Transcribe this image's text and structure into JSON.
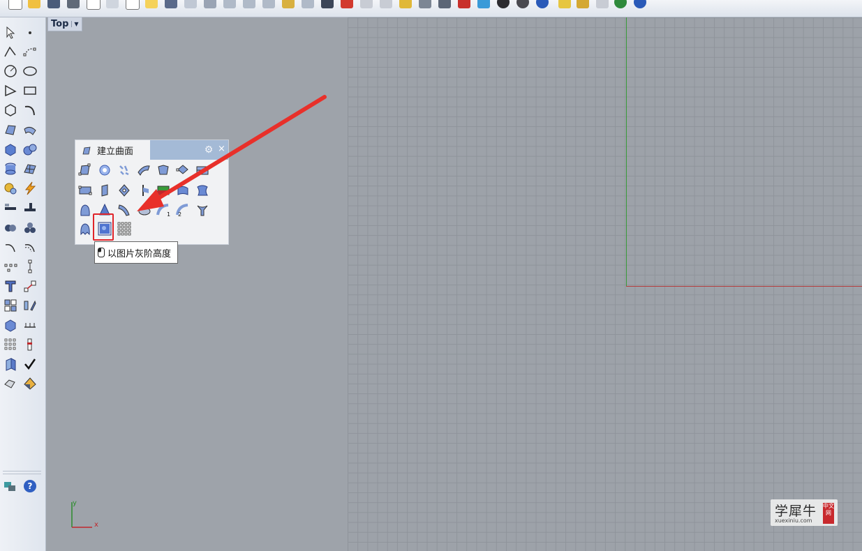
{
  "viewport": {
    "name": "Top",
    "axis_x_label": "x",
    "axis_y_label": "y"
  },
  "panel": {
    "title": "建立曲面",
    "close_glyph": "×",
    "settings_icon": "gear-icon",
    "tooltip": "以图片灰阶高度"
  },
  "watermark": {
    "title": "学犀牛",
    "subtitle": "xuexiniu.com",
    "badge": "中文网"
  },
  "colors": {
    "viewport_bg": "#9ea3aa",
    "grid_line": "#8f949b",
    "x_axis": "#b53b3b",
    "y_axis": "#3a9a3a",
    "panel_header": "#a4bad6",
    "highlight": "#e0242a",
    "arrow": "#e8302a"
  }
}
